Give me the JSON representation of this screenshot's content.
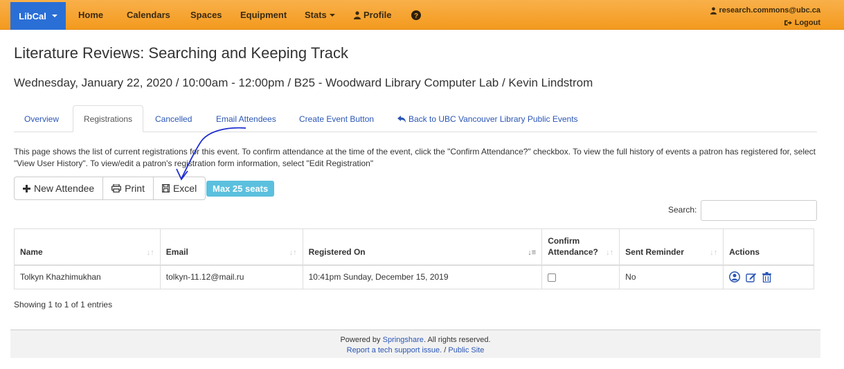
{
  "navbar": {
    "brand": "LibCal",
    "items": [
      "Home",
      "Calendars",
      "Spaces",
      "Equipment",
      "Stats",
      "Profile"
    ],
    "user_email": "research.commons@ubc.ca",
    "logout": "Logout"
  },
  "event": {
    "title": "Literature Reviews: Searching and Keeping Track",
    "subtitle": "Wednesday, January 22, 2020 / 10:00am - 12:00pm / B25 - Woodward Library Computer Lab / Kevin Lindstrom"
  },
  "tabs": [
    "Overview",
    "Registrations",
    "Cancelled",
    "Email Attendees",
    "Create Event Button",
    "Back to UBC Vancouver Library Public Events"
  ],
  "info_text": "This page shows the list of current registrations for this event. To confirm attendance at the time of the event, click the \"Confirm Attendance?\" checkbox. To view the full history of events a patron has registered for, select \"View User History\". To view/edit a patron's registration form information, select \"Edit Registration\"",
  "toolbar": {
    "new_attendee": "New Attendee",
    "print": "Print",
    "excel": "Excel",
    "seats_badge": "Max 25 seats"
  },
  "search": {
    "label": "Search:",
    "value": ""
  },
  "table": {
    "headers": [
      "Name",
      "Email",
      "Registered On",
      "Confirm Attendance?",
      "Sent Reminder",
      "Actions"
    ],
    "rows": [
      {
        "name": "Tolkyn Khazhimukhan",
        "email": "tolkyn-11.12@mail.ru",
        "registered_on": "10:41pm Sunday, December 15, 2019",
        "confirmed": false,
        "sent_reminder": "No"
      }
    ]
  },
  "showing": "Showing 1 to 1 of 1 entries",
  "footer": {
    "powered_prefix": "Powered by",
    "powered_link": "Springshare",
    "powered_suffix": ". All rights reserved.",
    "support_link": "Report a tech support issue.",
    "separator": " / ",
    "public_link": "Public Site"
  },
  "colors": {
    "navbar": "#f39a1e",
    "brand": "#2a6fd6",
    "link": "#2a56b5",
    "badge": "#5bc0de"
  }
}
